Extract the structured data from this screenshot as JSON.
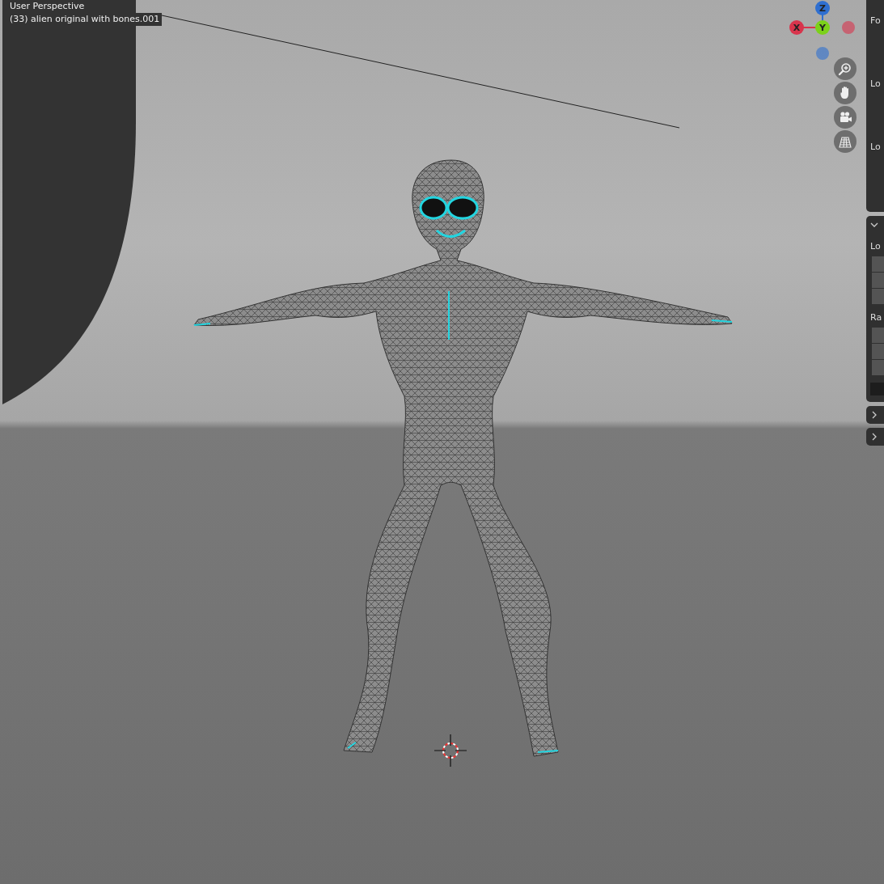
{
  "viewport": {
    "view_name": "User Perspective",
    "object_label": "(33) alien original with bones.001"
  },
  "axis_gizmo": {
    "axes": [
      {
        "label": "Z",
        "color": "#2f6fd0"
      },
      {
        "label": "X",
        "color": "#d8344c"
      },
      {
        "label": "Y",
        "color": "#7cd11a"
      }
    ]
  },
  "nav_buttons": [
    {
      "kind": "zoom"
    },
    {
      "kind": "pan"
    },
    {
      "kind": "camera"
    },
    {
      "kind": "grid"
    }
  ],
  "sidebar": {
    "panels": [
      {
        "kind": "continued",
        "labels": [
          "Fo",
          "Lo",
          "Lo"
        ]
      },
      {
        "kind": "section",
        "expanded": true,
        "labels": [
          "Lo",
          "Ra"
        ]
      },
      {
        "kind": "section",
        "expanded": false
      },
      {
        "kind": "section",
        "expanded": false
      }
    ]
  }
}
